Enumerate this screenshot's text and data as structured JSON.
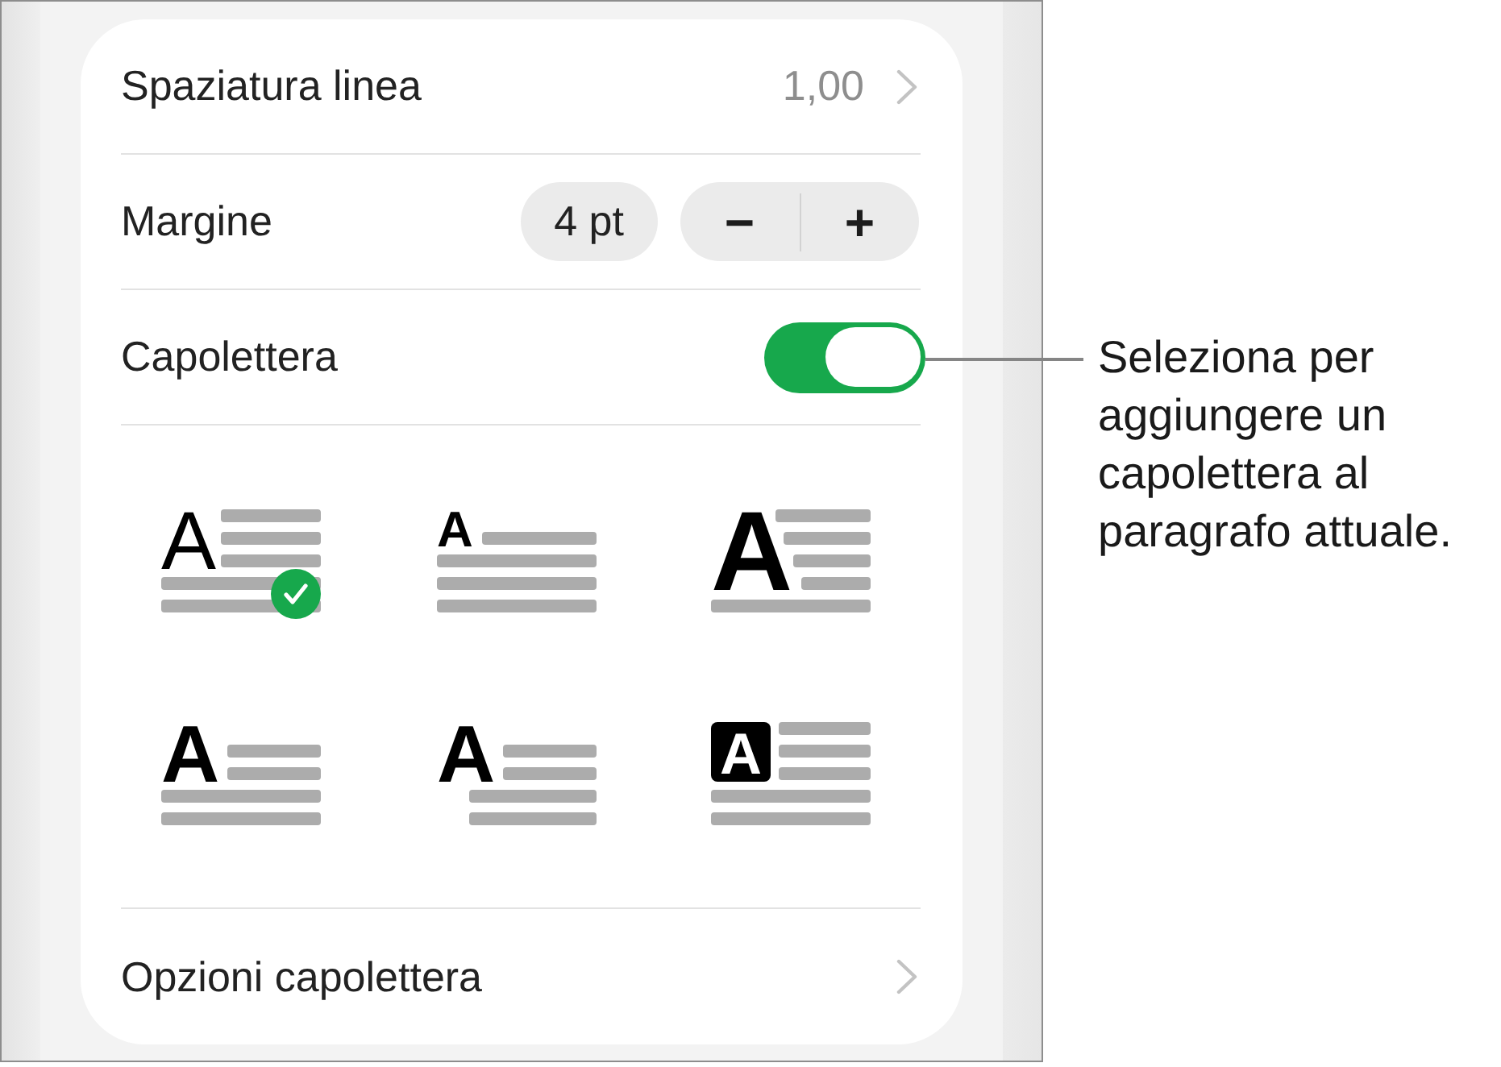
{
  "settings": [
    {
      "kind": "value",
      "label": "Spaziatura linea",
      "value": "1,00"
    },
    {
      "kind": "stepper",
      "label": "Margine",
      "value": "4 pt",
      "decrement": "−",
      "increment": "+"
    },
    {
      "kind": "toggle",
      "label": "Capolettera",
      "on": true
    }
  ],
  "drop_cap_styles": [
    {
      "kind": "raised-thin",
      "letter": "A",
      "selected": true
    },
    {
      "kind": "raised-small",
      "letter": "A",
      "selected": false
    },
    {
      "kind": "large",
      "letter": "A",
      "selected": false
    },
    {
      "kind": "drop",
      "letter": "A",
      "selected": false
    },
    {
      "kind": "hanging",
      "letter": "A",
      "selected": false
    },
    {
      "kind": "boxed",
      "letter": "A",
      "selected": false
    }
  ],
  "footer": {
    "label": "Opzioni capolettera"
  },
  "callout": {
    "text": "Seleziona per aggiungere un capolettera al paragrafo attuale."
  }
}
